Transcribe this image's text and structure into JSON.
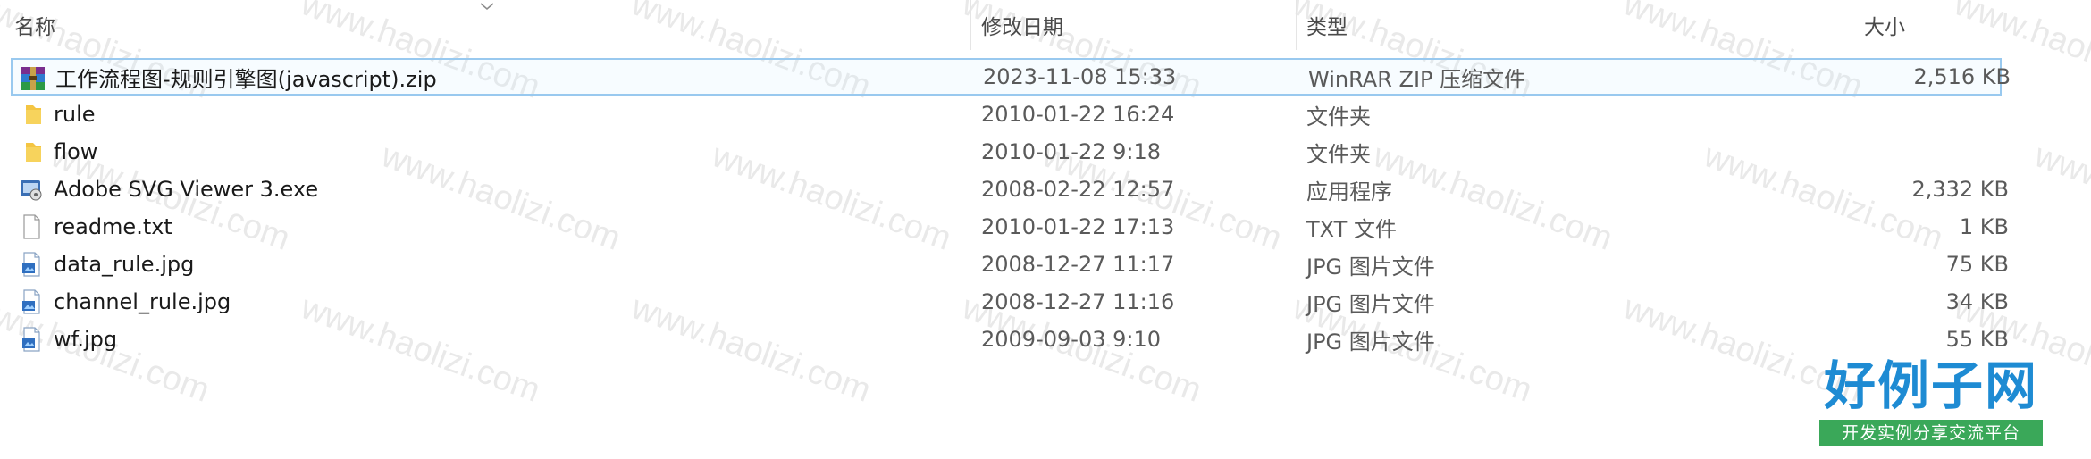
{
  "watermark": "www.haolizi.com",
  "columns": {
    "name": "名称",
    "modified": "修改日期",
    "type": "类型",
    "size": "大小"
  },
  "files": [
    {
      "name": "工作流程图-规则引擎图(javascript).zip",
      "modified": "2023-11-08 15:33",
      "type": "WinRAR ZIP 压缩文件",
      "size": "2,516 KB",
      "icon": "winrar-archive-icon",
      "selected": true
    },
    {
      "name": "rule",
      "modified": "2010-01-22 16:24",
      "type": "文件夹",
      "size": "",
      "icon": "folder-icon"
    },
    {
      "name": "flow",
      "modified": "2010-01-22 9:18",
      "type": "文件夹",
      "size": "",
      "icon": "folder-icon"
    },
    {
      "name": "Adobe SVG Viewer 3.exe",
      "modified": "2008-02-22 12:57",
      "type": "应用程序",
      "size": "2,332 KB",
      "icon": "installer-icon"
    },
    {
      "name": "readme.txt",
      "modified": "2010-01-22 17:13",
      "type": "TXT 文件",
      "size": "1 KB",
      "icon": "text-file-icon"
    },
    {
      "name": "data_rule.jpg",
      "modified": "2008-12-27 11:17",
      "type": "JPG 图片文件",
      "size": "75 KB",
      "icon": "image-file-icon"
    },
    {
      "name": "channel_rule.jpg",
      "modified": "2008-12-27 11:16",
      "type": "JPG 图片文件",
      "size": "34 KB",
      "icon": "image-file-icon"
    },
    {
      "name": "wf.jpg",
      "modified": "2009-09-03 9:10",
      "type": "JPG 图片文件",
      "size": "55 KB",
      "icon": "image-file-icon"
    }
  ],
  "logo": {
    "title": "好例子网",
    "subtitle": "开发实例分享交流平台"
  },
  "colors": {
    "selection_border": "#99c9ef",
    "folder": "#f4c542",
    "logo_blue": "#1e8bd3",
    "logo_green": "#3aa859"
  }
}
